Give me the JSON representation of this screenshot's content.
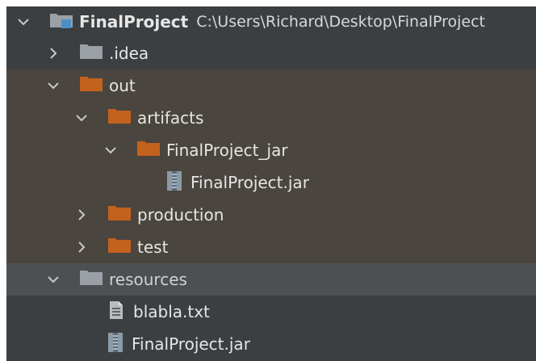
{
  "project": {
    "name": "FinalProject",
    "path": "C:\\Users\\Richard\\Desktop\\FinalProject"
  },
  "tree": {
    "idea": ".idea",
    "out": "out",
    "artifacts": "artifacts",
    "finalproject_jar_folder": "FinalProject_jar",
    "finalproject_jar_file": "FinalProject.jar",
    "production": "production",
    "test": "test",
    "resources": "resources",
    "blabla": "blabla.txt",
    "resources_jar": "FinalProject.jar"
  },
  "colors": {
    "background": "#3c3f41",
    "brown_row": "#4a453e",
    "selected_row": "#4d5052",
    "folder_orange": "#c2621d",
    "folder_gray": "#9aa0a6",
    "module_blue": "#4a90c8",
    "text": "#e6e6e6"
  },
  "icons": {
    "collapsed": "chevron-right-icon",
    "expanded": "chevron-down-icon",
    "module": "module-folder-icon",
    "folder": "folder-icon",
    "excluded_folder": "excluded-folder-icon",
    "jar": "jar-file-icon",
    "text_file": "text-file-icon"
  }
}
